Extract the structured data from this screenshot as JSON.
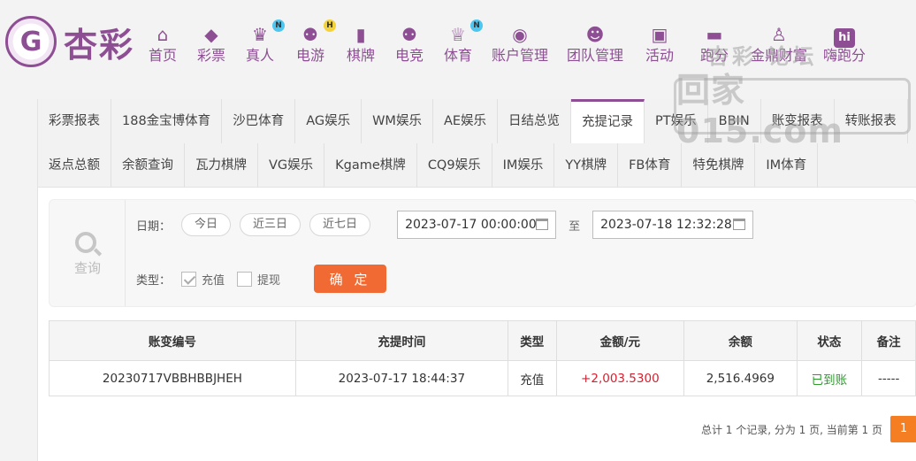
{
  "logo": {
    "mark": "G",
    "text": "杏彩"
  },
  "nav": [
    {
      "label": "首页",
      "icon": "⌂",
      "icon_name": "home-icon"
    },
    {
      "label": "彩票",
      "icon": "◆",
      "icon_name": "lottery-icon"
    },
    {
      "label": "真人",
      "icon": "♛",
      "icon_name": "live-dealer-icon",
      "badge": "N",
      "badge_color": "#4fc6f0"
    },
    {
      "label": "电游",
      "icon": "⚉",
      "icon_name": "gamepad-icon",
      "badge": "H",
      "badge_color": "#f3d23a"
    },
    {
      "label": "棋牌",
      "icon": "▮",
      "icon_name": "cards-icon"
    },
    {
      "label": "电竞",
      "icon": "⚉",
      "icon_name": "esports-icon"
    },
    {
      "label": "体育",
      "icon": "♕",
      "icon_name": "trophy-icon",
      "badge": "N",
      "badge_color": "#4fc6f0"
    },
    {
      "label": "账户管理",
      "icon": "◉",
      "icon_name": "account-icon"
    },
    {
      "label": "团队管理",
      "icon": "☻",
      "icon_name": "team-icon"
    },
    {
      "label": "活动",
      "icon": "▣",
      "icon_name": "gift-icon"
    },
    {
      "label": "跑分",
      "icon": "▬",
      "icon_name": "run-score-icon"
    },
    {
      "label": "金鼎财富",
      "icon": "♙",
      "icon_name": "wealth-icon"
    },
    {
      "label": "嗨跑分",
      "icon": "hi",
      "icon_name": "hi-icon"
    }
  ],
  "watermark": {
    "top": "杏彩 论坛",
    "main": "回家015.com"
  },
  "tabs_row1": [
    "彩票报表",
    "188金宝博体育",
    "沙巴体育",
    "AG娱乐",
    "WM娱乐",
    "AE娱乐",
    "日结总览",
    "充提记录",
    "PT娱乐",
    "BBIN",
    "账变报表",
    "转账报表"
  ],
  "tabs_row2": [
    "返点总额",
    "余额查询",
    "瓦力棋牌",
    "VG娱乐",
    "Kgame棋牌",
    "CQ9娱乐",
    "IM娱乐",
    "YY棋牌",
    "FB体育",
    "特免棋牌",
    "IM体育"
  ],
  "active_tab": "充提记录",
  "search": {
    "label": "查询",
    "date_label": "日期：",
    "quick": [
      "今日",
      "近三日",
      "近七日"
    ],
    "date_from": "2023-07-17 00:00:00",
    "to_label": "至",
    "date_to": "2023-07-18 12:32:28",
    "type_label": "类型：",
    "type_options": [
      {
        "label": "充值",
        "checked": true
      },
      {
        "label": "提现",
        "checked": false
      }
    ],
    "confirm_label": "确 定"
  },
  "table": {
    "headers": [
      "账变编号",
      "充提时间",
      "类型",
      "金额/元",
      "余额",
      "状态",
      "备注"
    ],
    "rows": [
      [
        "20230717VBBHBBJHEH",
        "2023-07-17 18:44:37",
        "充值",
        "+2,003.5300",
        "2,516.4969",
        "已到账",
        "-----"
      ]
    ]
  },
  "pagination": {
    "summary": "总计 1 个记录, 分为 1 页, 当前第 1 页",
    "current_page": "1"
  },
  "colors": {
    "brand": "#8e4e94",
    "confirm": "#f26a33",
    "page_active": "#f57e22",
    "amount": "#d6202f",
    "status_ok": "#2e9a2e"
  }
}
